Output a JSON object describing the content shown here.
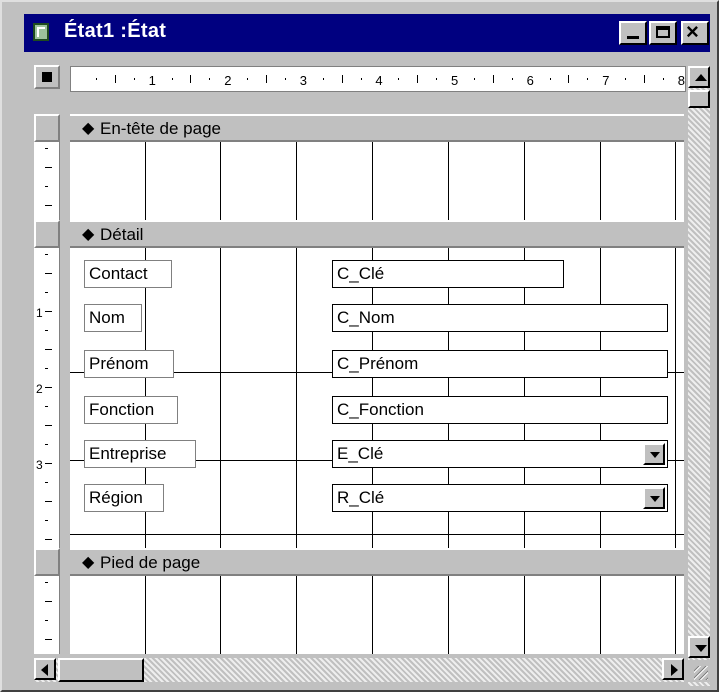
{
  "window": {
    "title": "État1 :État",
    "colors": {
      "title_bar": "#000080",
      "face": "#c0c0c0"
    }
  },
  "icons": {
    "app": "report-icon",
    "minimize": "minimize-icon",
    "maximize": "maximize-icon",
    "close": "close-icon"
  },
  "ruler": {
    "numbers": [
      "1",
      "2",
      "3",
      "4",
      "5",
      "6",
      "7",
      "8"
    ],
    "vertical_numbers": [
      "1",
      "2",
      "3"
    ]
  },
  "bands": {
    "page_header": "En-tête de page",
    "detail": "Détail",
    "page_footer": "Pied de page"
  },
  "detail_controls": [
    {
      "label": "Contact",
      "field": "C_Clé",
      "dropdown": false
    },
    {
      "label": "Nom",
      "field": "C_Nom",
      "dropdown": false
    },
    {
      "label": "Prénom",
      "field": "C_Prénom",
      "dropdown": false
    },
    {
      "label": "Fonction",
      "field": "C_Fonction",
      "dropdown": false
    },
    {
      "label": "Entreprise",
      "field": "E_Clé",
      "dropdown": true
    },
    {
      "label": "Région",
      "field": "R_Clé",
      "dropdown": true
    }
  ],
  "band_arrow_glyph": "◆"
}
